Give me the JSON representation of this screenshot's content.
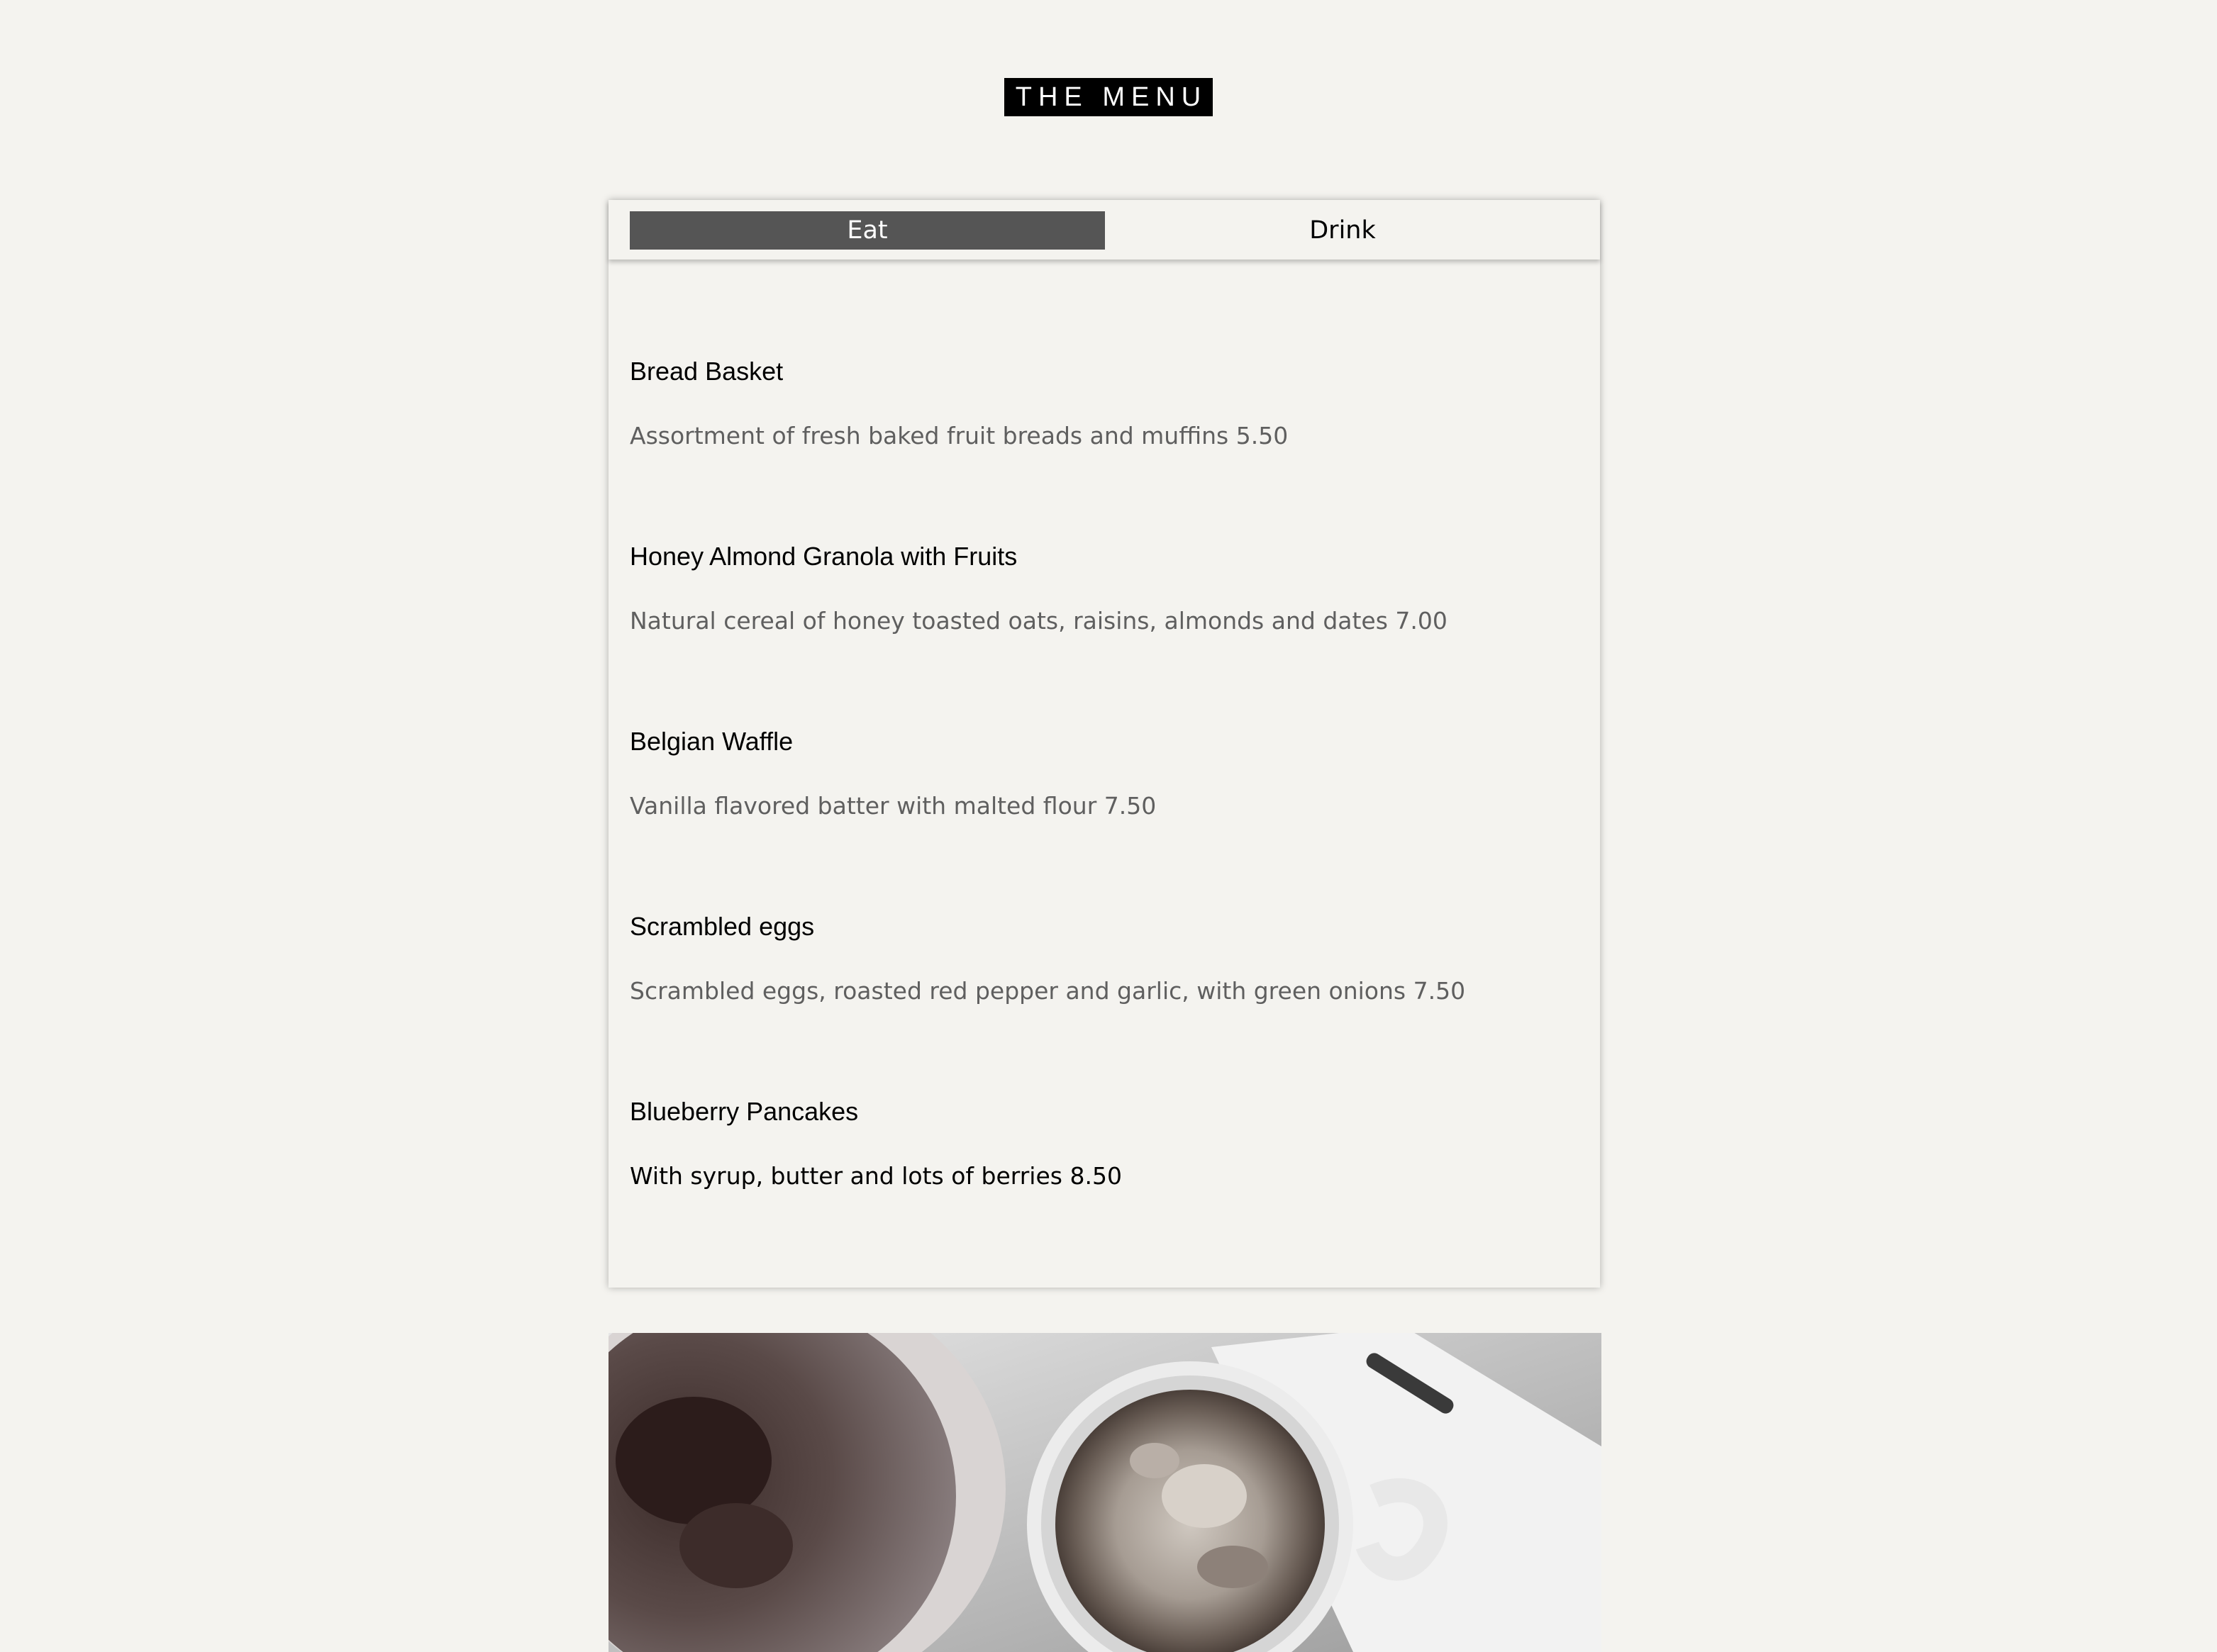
{
  "header": {
    "title": "THE MENU"
  },
  "tabs": [
    {
      "label": "Eat",
      "active": true
    },
    {
      "label": "Drink",
      "active": false
    }
  ],
  "items": [
    {
      "name": "Bread Basket",
      "description": "Assortment of fresh baked fruit breads and muffins 5.50"
    },
    {
      "name": "Honey Almond Granola with Fruits",
      "description": "Natural cereal of honey toasted oats, raisins, almonds and dates 7.00"
    },
    {
      "name": "Belgian Waffle",
      "description": "Vanilla flavored batter with malted flour 7.50"
    },
    {
      "name": "Scrambled eggs",
      "description": "Scrambled eggs, roasted red pepper and garlic, with green onions 7.50"
    },
    {
      "name": "Blueberry Pancakes",
      "description": "With syrup, butter and lots of berries 8.50"
    }
  ],
  "colors": {
    "background": "#f4f3ef",
    "active_tab": "#555555",
    "description_text": "#5f5f5f",
    "title_background": "#000000"
  }
}
